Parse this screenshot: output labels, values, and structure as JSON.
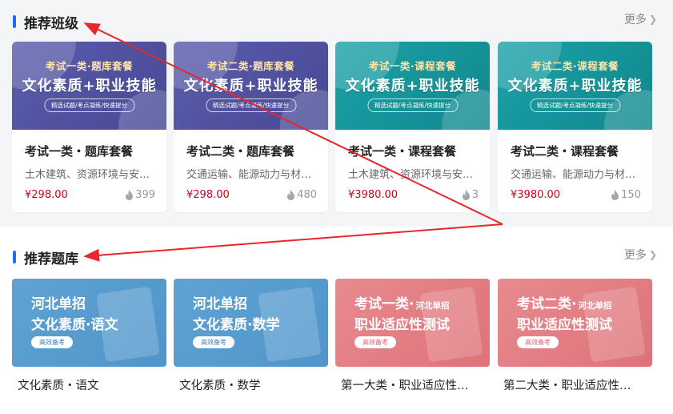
{
  "section1": {
    "title": "推荐班级",
    "more": "更多",
    "cards": [
      {
        "banner_line1": "考试一类·题库套餐",
        "banner_line2": "文化素质+职业技能",
        "banner_tag": "精选试题/考点凝练/快速提分",
        "title": "考试一类・题库套餐",
        "desc": "土木建筑、资源环境与安…",
        "price": "¥298.00",
        "count": "399",
        "theme": "purple"
      },
      {
        "banner_line1": "考试二类·题库套餐",
        "banner_line2": "文化素质+职业技能",
        "banner_tag": "精选试题/考点凝练/快速提分",
        "title": "考试二类・题库套餐",
        "desc": "交通运输、能源动力与材…",
        "price": "¥298.00",
        "count": "480",
        "theme": "purple"
      },
      {
        "banner_line1": "考试一类·课程套餐",
        "banner_line2": "文化素质+职业技能",
        "banner_tag": "精选试题/考点凝练/快速提分",
        "title": "考试一类・课程套餐",
        "desc": "土木建筑、资源环境与安…",
        "price": "¥3980.00",
        "count": "3",
        "theme": "teal"
      },
      {
        "banner_line1": "考试二类·课程套餐",
        "banner_line2": "文化素质+职业技能",
        "banner_tag": "精选试题/考点凝练/快速提分",
        "title": "考试二类・课程套餐",
        "desc": "交通运输、能源动力与材…",
        "price": "¥3980.00",
        "count": "150",
        "theme": "teal"
      }
    ]
  },
  "section2": {
    "title": "推荐题库",
    "more": "更多",
    "cards": [
      {
        "banner_line1": "河北单招",
        "banner_line1_small": "",
        "banner_line2": "文化素质·语文",
        "banner_tag": "高效备考",
        "title": "文化素质・语文",
        "theme": "blue"
      },
      {
        "banner_line1": "河北单招",
        "banner_line1_small": "",
        "banner_line2": "文化素质·数学",
        "banner_tag": "高效备考",
        "title": "文化素质・数学",
        "theme": "blue"
      },
      {
        "banner_line1": "考试一类·",
        "banner_line1_small": "河北单招",
        "banner_line2": "职业适应性测试",
        "banner_tag": "高效备考",
        "title": "第一大类・职业适应性…",
        "theme": "pink"
      },
      {
        "banner_line1": "考试二类·",
        "banner_line1_small": "河北单招",
        "banner_line2": "职业适应性测试",
        "banner_tag": "高效备考",
        "title": "第二大类・职业适应性…",
        "theme": "pink"
      }
    ]
  },
  "colors": {
    "accent": "#1e6bff",
    "price": "#d0021b",
    "annotation_arrow": "#e8262b"
  }
}
